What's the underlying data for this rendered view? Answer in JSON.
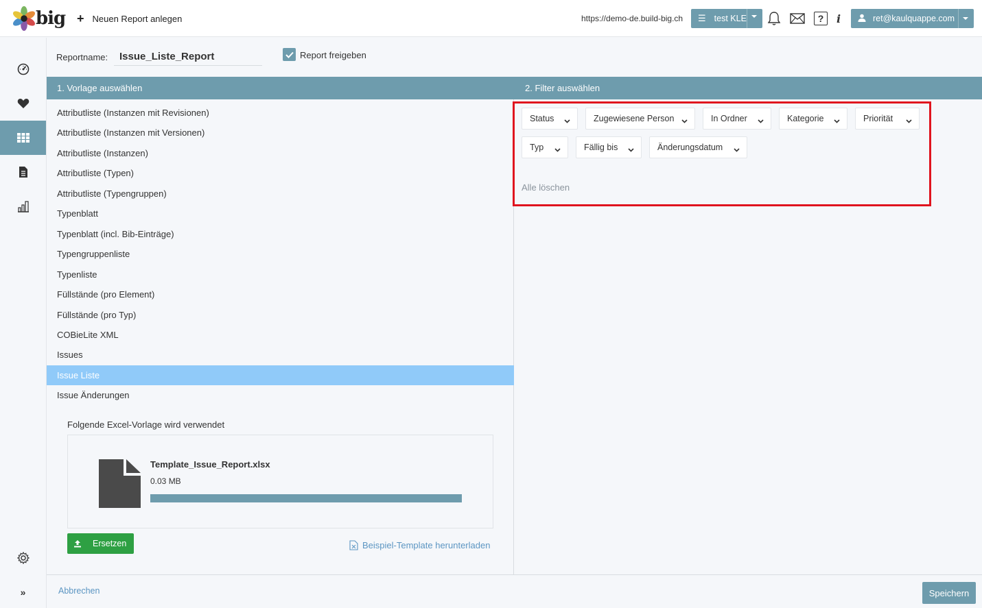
{
  "topbar": {
    "logo_text": "big",
    "new_report_label": "Neuen Report anlegen",
    "url": "https://demo-de.build-big.ch",
    "project_label": "test KLE",
    "info_label": "i",
    "help_label": "?",
    "user_email": "ret@kaulquappe.com"
  },
  "sidebar": {
    "items": [
      {
        "icon": "dashboard-icon"
      },
      {
        "icon": "heart-icon"
      },
      {
        "icon": "grid-icon",
        "active": true
      },
      {
        "icon": "document-icon"
      },
      {
        "icon": "building-chart-icon"
      }
    ],
    "bottom": [
      {
        "icon": "gear-icon"
      },
      {
        "icon": "double-chevron-right-icon"
      }
    ]
  },
  "report": {
    "name_label": "Reportname:",
    "name_value": "Issue_Liste_Report",
    "share_label": "Report freigeben",
    "share_checked": true
  },
  "sections": {
    "template_title": "1. Vorlage auswählen",
    "filter_title": "2. Filter auswählen"
  },
  "templates": [
    "Attributliste (Instanzen mit Revisionen)",
    "Attributliste (Instanzen mit Versionen)",
    "Attributliste (Instanzen)",
    "Attributliste (Typen)",
    "Attributliste (Typengruppen)",
    "Typenblatt",
    "Typenblatt (incl. Bib-Einträge)",
    "Typengruppenliste",
    "Typenliste",
    "Füllstände (pro Element)",
    "Füllstände (pro Typ)",
    "COBieLite XML",
    "Issues",
    "Issue Liste",
    "Issue Änderungen"
  ],
  "selected_template": "Issue Liste",
  "excel": {
    "label": "Folgende Excel-Vorlage wird verwendet",
    "file_name": "Template_Issue_Report.xlsx",
    "file_size": "0.03 MB",
    "progress": 1.0,
    "replace_label": "Ersetzen",
    "download_label": "Beispiel-Template herunterladen"
  },
  "filters": {
    "row1": [
      "Status",
      "Zugewiesene Person",
      "In Ordner",
      "Kategorie",
      "Priorität"
    ],
    "row2": [
      "Typ",
      "Fällig bis",
      "Änderungsdatum"
    ],
    "clear_label": "Alle löschen"
  },
  "footer": {
    "cancel_label": "Abbrechen",
    "save_label": "Speichern"
  },
  "colors": {
    "accent": "#6e9cad",
    "selected": "#90caf9",
    "success": "#2ea043",
    "highlight_border": "#e0141e",
    "link": "#5b95c2"
  }
}
